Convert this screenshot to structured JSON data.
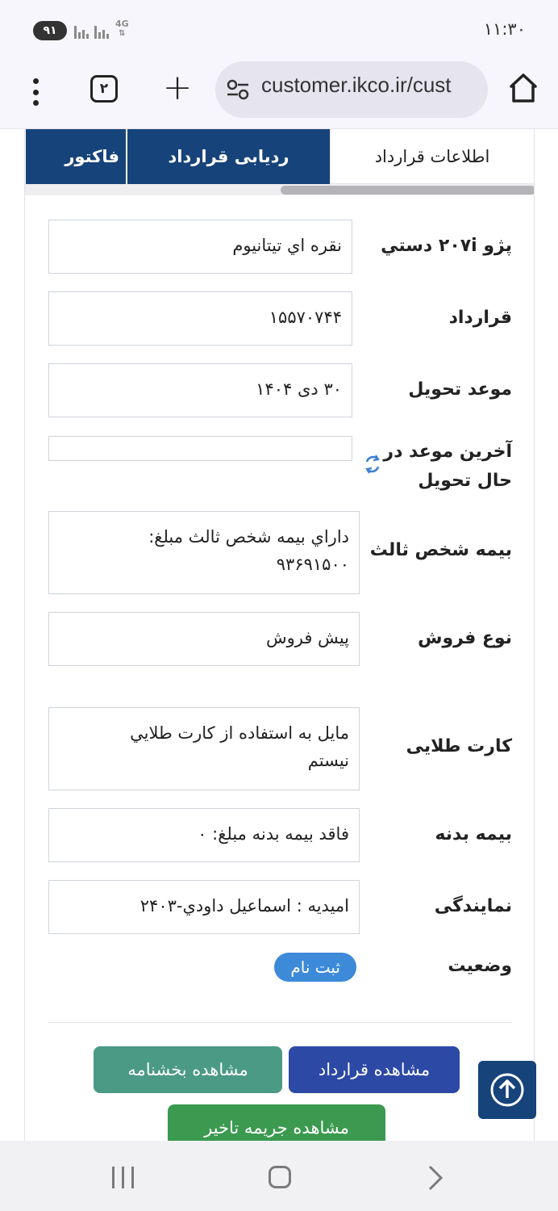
{
  "status_bar": {
    "battery": "۹۱",
    "network": "4G",
    "time": "۱۱:۳۰"
  },
  "browser": {
    "url": "customer.ikco.ir/cust",
    "tab_count": "۲"
  },
  "tabs": [
    {
      "label": "اطلاعات قرارداد",
      "active": true
    },
    {
      "label": "ردیابی قرارداد",
      "active": false
    },
    {
      "label": "فاکتور",
      "active": false
    }
  ],
  "fields": {
    "car": {
      "label": "پژو ۲۰۷i دستي",
      "value": "نقره اي تيتانيوم"
    },
    "contract": {
      "label": "قرارداد",
      "value": "۱۵۵۷۰۷۴۴"
    },
    "delivery_date": {
      "label": "موعد تحویل",
      "value": "۳۰ دی ۱۴۰۴"
    },
    "last_delivery": {
      "label_line1": "آخرین موعد در",
      "label_line2": "حال تحویل",
      "value": ""
    },
    "third_party": {
      "label": "بیمه شخص ثالث",
      "value_line1": "داراي بيمه شخص ثالث مبلغ:",
      "value_line2": "۹۳۶۹۱۵۰۰"
    },
    "sale_type": {
      "label": "نوع فروش",
      "value": "پیش فروش"
    },
    "gold_card": {
      "label": "کارت طلایی",
      "value_line1": "مايل به استفاده از کارت طلايي",
      "value_line2": "نيستم"
    },
    "body_insurance": {
      "label": "بیمه بدنه",
      "value": "فاقد بيمه بدنه مبلغ: ۰"
    },
    "agency": {
      "label": "نمایندگی",
      "value": "اميديه : اسماعيل داودي-۲۴۰۳"
    },
    "status": {
      "label": "وضعیت",
      "value": "ثبت نام"
    }
  },
  "buttons": {
    "view_contract": "مشاهده قرارداد",
    "view_circular": "مشاهده بخشنامه",
    "view_penalty": "مشاهده جریمه تاخیر"
  },
  "colors": {
    "primary": "#16437a",
    "button_blue": "#2c49a6",
    "button_teal": "#4a9a86",
    "button_green": "#3b9a4f",
    "badge_blue": "#3d8ad9"
  }
}
